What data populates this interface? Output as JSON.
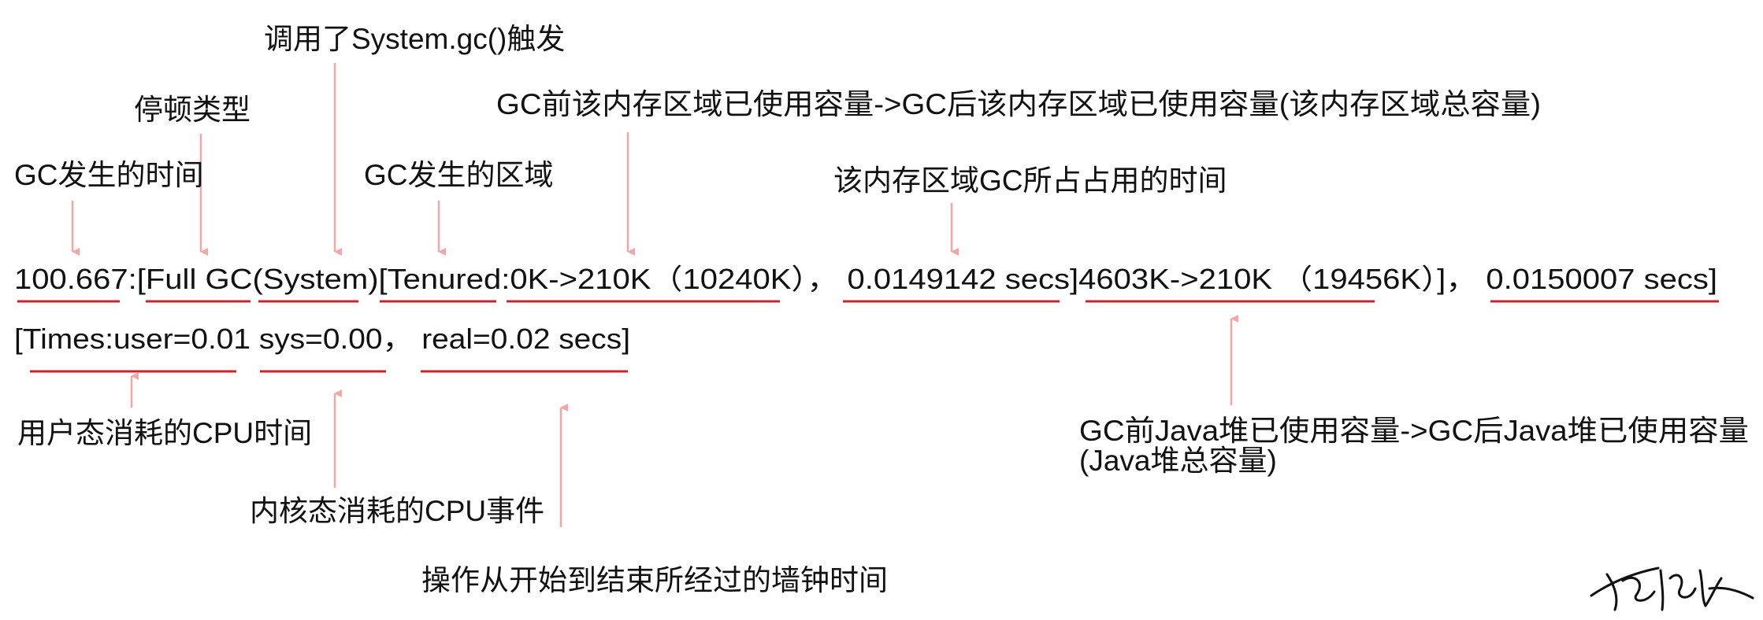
{
  "log": {
    "line1": "100.667:[Full  GC(System)[Tenured:0K->210K（10240K）， 0.0149142  secs]4603K->210K （19456K）]，  0.0150007  secs]",
    "line2": "[Times:user=0.01  sys=0.00， real=0.02  secs]"
  },
  "labels": {
    "gc_time": "GC发生的时间",
    "pause_type": "停顿类型",
    "system_gc": "调用了System.gc()触发",
    "gc_area": "GC发生的区域",
    "region_usage": "GC前该内存区域已使用容量->GC后该内存区域已使用容量(该内存区域总容量)",
    "region_time": "该内存区域GC所占占用的时间",
    "heap_usage_line1": "GC前Java堆已使用容量->GC后Java堆已使用容量",
    "heap_usage_line2": "(Java堆总容量)",
    "user_cpu": "用户态消耗的CPU时间",
    "kernel_cpu": "内核态消耗的CPU事件",
    "wall_clock": "操作从开始到结束所经过的墙钟时间"
  },
  "colors": {
    "underline": "#c8242b",
    "arrow": "#f4a6a6",
    "text": "#111111"
  }
}
